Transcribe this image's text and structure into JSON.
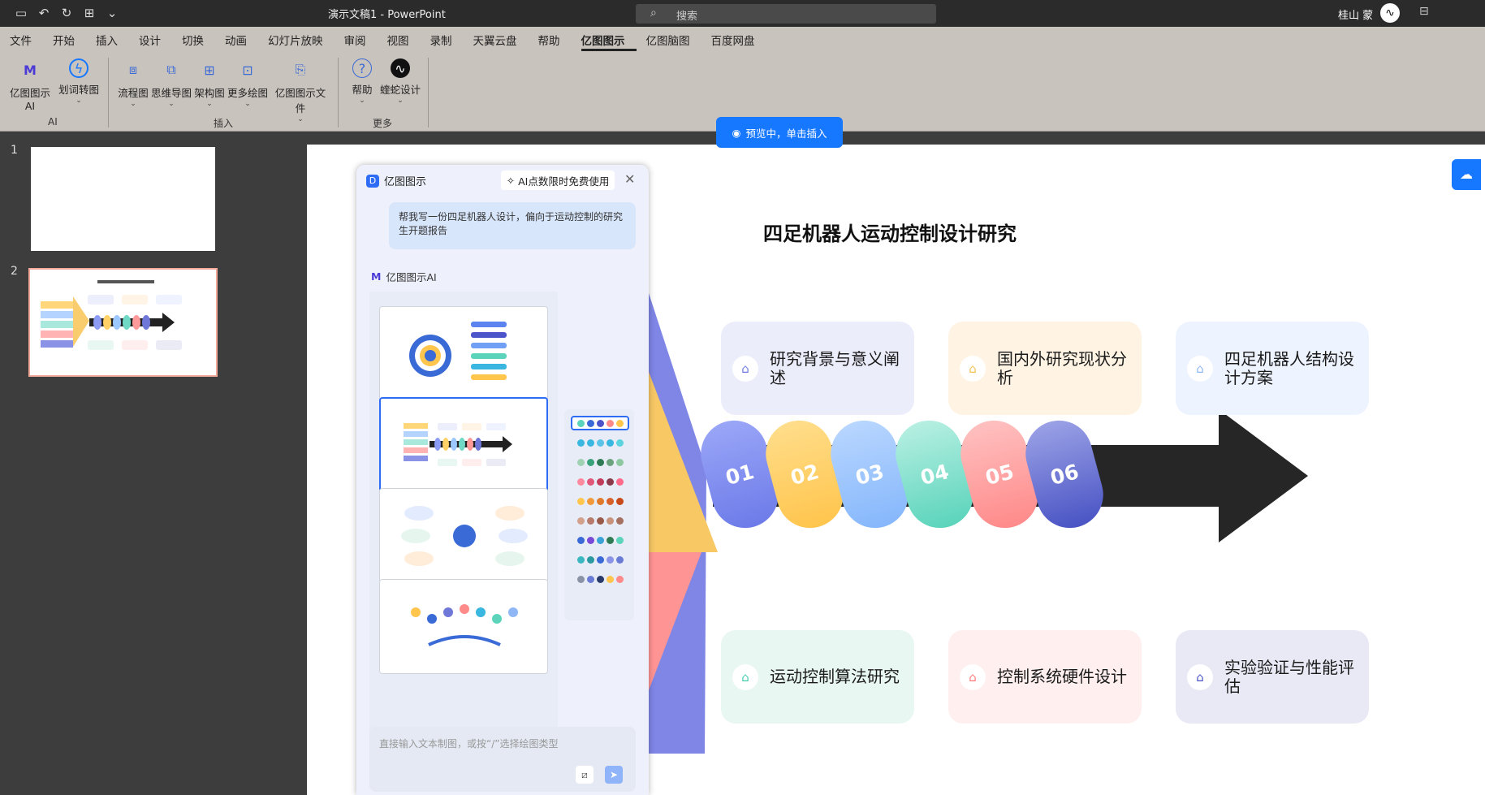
{
  "titlebar": {
    "doc": "演示文稿1 - PowerPoint",
    "search": "搜索",
    "user": "桂山 蒙"
  },
  "tabs": [
    "文件",
    "开始",
    "插入",
    "设计",
    "切换",
    "动画",
    "幻灯片放映",
    "审阅",
    "视图",
    "录制",
    "天翼云盘",
    "帮助",
    "亿图图示",
    "亿图脑图",
    "百度网盘"
  ],
  "active_tab": "亿图图示",
  "ribbon": {
    "buttons": {
      "ai": "亿图图示AI",
      "convert": "划词转图",
      "flow": "流程图",
      "mind": "思维导图",
      "arch": "架构图",
      "more": "更多绘图",
      "file": "亿图图示文件",
      "help": "帮助",
      "design": "蝰蛇设计"
    },
    "groups": {
      "ai": "AI",
      "insert": "插入",
      "more": "更多"
    }
  },
  "slides": {
    "n1": "1",
    "n2": "2"
  },
  "preview_label": "预览中，单击插入",
  "slide": {
    "title": "四足机器人运动控制设计研究",
    "cards": [
      "研究背景与意义阐述",
      "国内外研究现状分析",
      "四足机器人结构设计方案",
      "运动控制算法研究",
      "控制系统硬件设计",
      "实验验证与性能评估"
    ],
    "numbers": [
      "01",
      "02",
      "03",
      "04",
      "05",
      "06"
    ]
  },
  "panel": {
    "title": "亿图图示",
    "badge": "AI点数限时免费使用",
    "prompt": "帮我写一份四足机器人设计，偏向于运动控制的研究生开题报告",
    "ai_label": "亿图图示AI",
    "input_placeholder": "直接输入文本制图，或按“/”选择绘图类型"
  },
  "colors": {
    "accent": "#1677ff",
    "tab_bg": "#c9c3bd"
  }
}
